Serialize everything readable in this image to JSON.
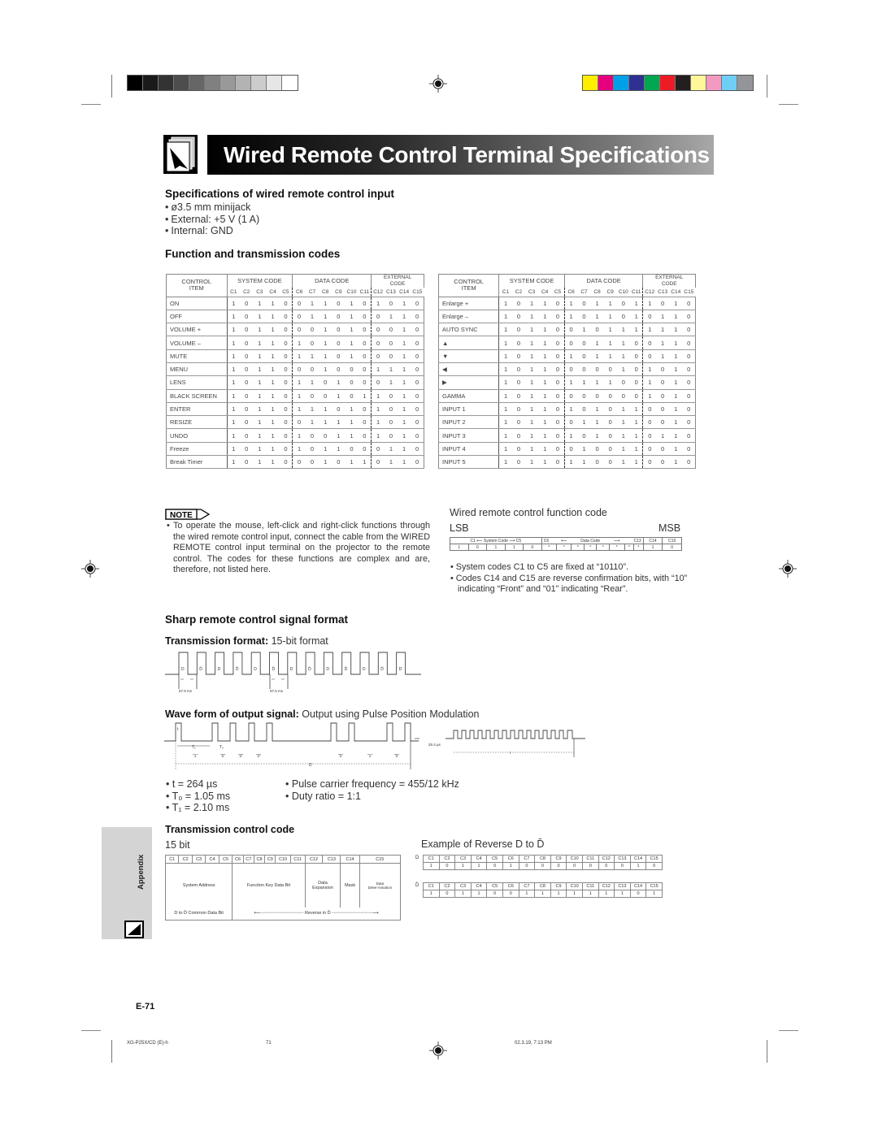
{
  "registration": {
    "gray_swatches": [
      "#000000",
      "#1a1a1a",
      "#333333",
      "#4d4d4d",
      "#666666",
      "#808080",
      "#999999",
      "#b3b3b3",
      "#cccccc",
      "#e6e6e6",
      "#ffffff"
    ],
    "color_swatches": [
      "#ffee00",
      "#e6007e",
      "#00a0e9",
      "#2e3192",
      "#00a650",
      "#ed1c24",
      "#231f20",
      "#fff799",
      "#f49ac1",
      "#6dcff6",
      "#939598"
    ]
  },
  "header": {
    "title": "Wired Remote Control Terminal Specifications"
  },
  "specs": {
    "heading": "Specifications of wired remote control input",
    "items": [
      "ø3.5 mm minijack",
      "External:  +5 V (1 A)",
      "Internal: GND"
    ]
  },
  "function_codes": {
    "heading": "Function and transmission codes",
    "headers": {
      "control_item": "CONTROL ITEM",
      "system_code": "SYSTEM CODE",
      "data_code": "DATA CODE",
      "external_code": "EXTERNAL CODE",
      "columns": [
        "C1",
        "C2",
        "C3",
        "C4",
        "C5",
        "C6",
        "C7",
        "C8",
        "C9",
        "C10",
        "C11",
        "C12",
        "C13",
        "C14",
        "C15"
      ]
    },
    "left_table": [
      {
        "item": "ON",
        "bits": [
          1,
          0,
          1,
          1,
          0,
          0,
          1,
          1,
          0,
          1,
          0,
          1,
          0,
          1,
          0
        ]
      },
      {
        "item": "OFF",
        "bits": [
          1,
          0,
          1,
          1,
          0,
          0,
          1,
          1,
          0,
          1,
          0,
          0,
          1,
          1,
          0
        ]
      },
      {
        "item": "VOLUME +",
        "bits": [
          1,
          0,
          1,
          1,
          0,
          0,
          0,
          1,
          0,
          1,
          0,
          0,
          0,
          1,
          0
        ]
      },
      {
        "item": "VOLUME –",
        "bits": [
          1,
          0,
          1,
          1,
          0,
          1,
          0,
          1,
          0,
          1,
          0,
          0,
          0,
          1,
          0
        ]
      },
      {
        "item": "MUTE",
        "bits": [
          1,
          0,
          1,
          1,
          0,
          1,
          1,
          1,
          0,
          1,
          0,
          0,
          0,
          1,
          0
        ]
      },
      {
        "item": "MENU",
        "bits": [
          1,
          0,
          1,
          1,
          0,
          0,
          0,
          1,
          0,
          0,
          0,
          1,
          1,
          1,
          0
        ]
      },
      {
        "item": "LENS",
        "bits": [
          1,
          0,
          1,
          1,
          0,
          1,
          1,
          0,
          1,
          0,
          0,
          0,
          1,
          1,
          0
        ]
      },
      {
        "item": "BLACK SCREEN",
        "bits": [
          1,
          0,
          1,
          1,
          0,
          1,
          0,
          0,
          1,
          0,
          1,
          1,
          0,
          1,
          0
        ]
      },
      {
        "item": "ENTER",
        "bits": [
          1,
          0,
          1,
          1,
          0,
          1,
          1,
          1,
          0,
          1,
          0,
          1,
          0,
          1,
          0
        ]
      },
      {
        "item": "RESIZE",
        "bits": [
          1,
          0,
          1,
          1,
          0,
          0,
          1,
          1,
          1,
          1,
          0,
          1,
          0,
          1,
          0
        ]
      },
      {
        "item": "UNDO",
        "bits": [
          1,
          0,
          1,
          1,
          0,
          1,
          0,
          0,
          1,
          1,
          0,
          1,
          0,
          1,
          0
        ]
      },
      {
        "item": "Freeze",
        "bits": [
          1,
          0,
          1,
          1,
          0,
          1,
          0,
          1,
          1,
          0,
          0,
          0,
          1,
          1,
          0
        ]
      },
      {
        "item": "Break Timer",
        "bits": [
          1,
          0,
          1,
          1,
          0,
          0,
          0,
          1,
          0,
          1,
          1,
          0,
          1,
          1,
          0
        ]
      }
    ],
    "right_table": [
      {
        "item": "Enlarge +",
        "bits": [
          1,
          0,
          1,
          1,
          0,
          1,
          0,
          1,
          1,
          0,
          1,
          1,
          0,
          1,
          0
        ]
      },
      {
        "item": "Enlarge –",
        "bits": [
          1,
          0,
          1,
          1,
          0,
          1,
          0,
          1,
          1,
          0,
          1,
          0,
          1,
          1,
          0
        ]
      },
      {
        "item": "AUTO SYNC",
        "bits": [
          1,
          0,
          1,
          1,
          0,
          0,
          1,
          0,
          1,
          1,
          1,
          1,
          1,
          1,
          0
        ]
      },
      {
        "item": "▲",
        "bits": [
          1,
          0,
          1,
          1,
          0,
          0,
          0,
          1,
          1,
          1,
          0,
          0,
          1,
          1,
          0
        ]
      },
      {
        "item": "▼",
        "bits": [
          1,
          0,
          1,
          1,
          0,
          1,
          0,
          1,
          1,
          1,
          0,
          0,
          1,
          1,
          0
        ]
      },
      {
        "item": "◀",
        "bits": [
          1,
          0,
          1,
          1,
          0,
          0,
          0,
          0,
          0,
          1,
          0,
          1,
          0,
          1,
          0
        ]
      },
      {
        "item": "▶",
        "bits": [
          1,
          0,
          1,
          1,
          0,
          1,
          1,
          1,
          1,
          0,
          0,
          1,
          0,
          1,
          0
        ]
      },
      {
        "item": "GAMMA",
        "bits": [
          1,
          0,
          1,
          1,
          0,
          0,
          0,
          0,
          0,
          0,
          0,
          1,
          0,
          1,
          0
        ]
      },
      {
        "item": "INPUT 1",
        "bits": [
          1,
          0,
          1,
          1,
          0,
          1,
          0,
          1,
          0,
          1,
          1,
          0,
          0,
          1,
          0
        ]
      },
      {
        "item": "INPUT 2",
        "bits": [
          1,
          0,
          1,
          1,
          0,
          0,
          1,
          1,
          0,
          1,
          1,
          0,
          0,
          1,
          0
        ]
      },
      {
        "item": "INPUT 3",
        "bits": [
          1,
          0,
          1,
          1,
          0,
          1,
          0,
          1,
          0,
          1,
          1,
          0,
          1,
          1,
          0
        ]
      },
      {
        "item": "INPUT 4",
        "bits": [
          1,
          0,
          1,
          1,
          0,
          0,
          1,
          0,
          0,
          1,
          1,
          0,
          0,
          1,
          0
        ]
      },
      {
        "item": "INPUT 5",
        "bits": [
          1,
          0,
          1,
          1,
          0,
          1,
          1,
          0,
          0,
          1,
          1,
          0,
          0,
          1,
          0
        ]
      }
    ]
  },
  "note": {
    "badge": "NOTE",
    "text": "To operate the mouse, left-click and right-click functions through the wired remote control input, connect the cable from the WIRED REMOTE control input terminal on the projector to the remote control. The codes for these functions are complex and are, therefore, not listed here."
  },
  "function_code_diagram": {
    "title": "Wired remote control function code",
    "lsb": "LSB",
    "msb": "MSB",
    "header": [
      "C1 ⟵ System Code ⟶ C5",
      "C6",
      "⟵",
      "Data Code",
      "⟶",
      "C13",
      "C14",
      "C15"
    ],
    "values": [
      "1",
      "0",
      "1",
      "1",
      "0",
      "*",
      "*",
      "*",
      "*",
      "*",
      "*",
      "*",
      "*",
      "1",
      "0"
    ],
    "bullets": [
      "System codes C1 to C5 are fixed at “10110”.",
      "Codes C14 and C15 are reverse confirmation bits, with “10” indicating “Front” and “01” indicating “Rear”."
    ]
  },
  "signal_format": {
    "heading": "Sharp remote control signal format",
    "transmission_format_label": "Transmission format:",
    "transmission_format_value": "15-bit format",
    "frame_labels": [
      "D",
      "D̄",
      "D",
      "D̄",
      "D",
      "D̄",
      "D",
      "D̄",
      "D",
      "D̄",
      "D",
      "D̄",
      "D"
    ],
    "interval_label": "67.5 ms",
    "waveform_label": "Wave form of output signal:",
    "waveform_value": "Output using Pulse Position Modulation",
    "wave_annotations": {
      "t": "t",
      "T1": "T₁",
      "T0": "T₀",
      "bits": [
        "“1”",
        "“0”",
        "“0”",
        "“0”",
        "“0”",
        "“1”",
        "“0”"
      ],
      "D": "D",
      "carrier": "26.4 µs",
      "carrier_span": "t"
    },
    "params_left": [
      "t  =  264 µs",
      "T₀  =  1.05 ms",
      "T₁  =  2.10 ms"
    ],
    "params_right": [
      "Pulse carrier frequency  =  455/12 kHz",
      "Duty ratio  =  1:1"
    ]
  },
  "transmission_control": {
    "heading": "Transmission control code",
    "bit_label": "15 bit",
    "columns": [
      "C1",
      "C2",
      "C3",
      "C4",
      "C5",
      "C6",
      "C7",
      "C8",
      "C9",
      "C10",
      "C11",
      "C12",
      "C13",
      "C14",
      "C15"
    ],
    "groups": {
      "system_address": "System Address",
      "function_key": "Function Key Data Bit",
      "data_expansion": "Data Expansion",
      "mask": "Mask",
      "data_determination": "Data Deter-mination"
    },
    "common": "D to D̄ Common Data Bit",
    "reverse": "Reverse in D̄"
  },
  "example": {
    "title": "Example of Reverse D to D̄",
    "columns": [
      "C1",
      "C2",
      "C3",
      "C4",
      "C5",
      "C6",
      "C7",
      "C8",
      "C9",
      "C10",
      "C11",
      "C12",
      "C13",
      "C14",
      "C15"
    ],
    "d_label": "D",
    "d_values": [
      "1",
      "0",
      "1",
      "1",
      "0",
      "1",
      "0",
      "0",
      "0",
      "0",
      "0",
      "0",
      "0",
      "1",
      "0"
    ],
    "dbar_label": "D̄",
    "dbar_values": [
      "1",
      "0",
      "1",
      "1",
      "0",
      "0",
      "1",
      "1",
      "1",
      "1",
      "1",
      "1",
      "1",
      "0",
      "1"
    ]
  },
  "sidebar": {
    "section": "Appendix"
  },
  "page": {
    "number": "E-71"
  },
  "footer": {
    "file": "XG-P25X/CD (E)-h",
    "page": "71",
    "timestamp": "02.3.19, 7:13 PM"
  }
}
